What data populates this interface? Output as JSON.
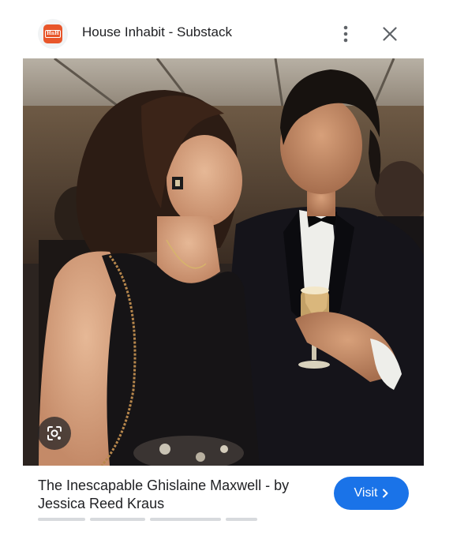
{
  "header": {
    "logo_icon": "house-inhabit-logo",
    "logo_text": "HnH",
    "site_name": "House Inhabit - Substack",
    "more_icon": "more-vert-icon",
    "close_icon": "close-icon"
  },
  "image": {
    "lens_icon": "google-lens-icon"
  },
  "result": {
    "title": "The Inescapable Ghislaine Maxwell - by Jessica Reed Kraus",
    "visit_label": "Visit",
    "visit_icon": "chevron-right-icon"
  },
  "colors": {
    "accent": "#1a73e8",
    "logo": "#e8562a"
  }
}
